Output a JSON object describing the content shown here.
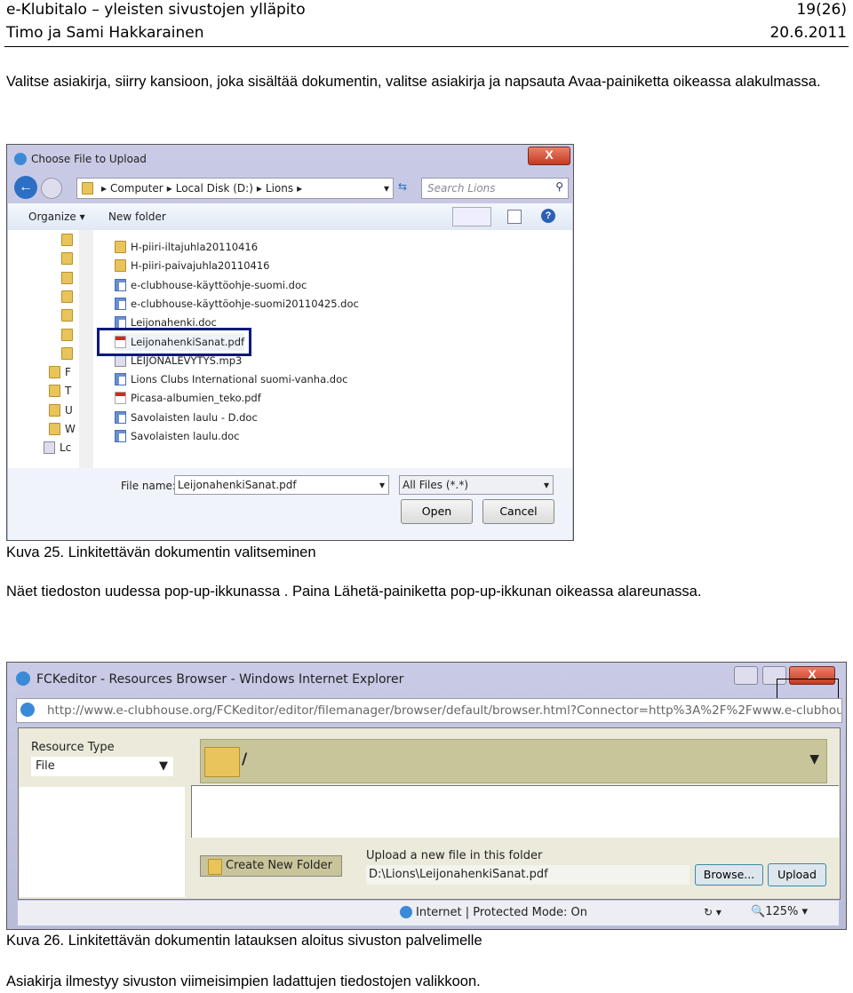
{
  "header": {
    "title": "e-Klubitalo – yleisten sivustojen ylläpito",
    "page": "19(26)",
    "authors": "Timo ja Sami Hakkarainen",
    "date": "20.6.2011"
  },
  "para1": "Valitse asiakirja, siirry kansioon, joka sisältää dokumentin, valitse asiakirja ja napsauta Avaa-painiketta oikeassa alakulmassa.",
  "dialog1": {
    "title": "Choose File to Upload",
    "close": "X",
    "breadcrumb": [
      "Computer",
      "Local Disk (D:)",
      "Lions"
    ],
    "search_placeholder": "Search Lions",
    "organize": "Organize ▾",
    "new_folder": "New folder",
    "nav_items": [
      "",
      "",
      "",
      "",
      "",
      "",
      "",
      "F",
      "T",
      "U",
      "W",
      "Lc"
    ],
    "files": [
      {
        "name": "H-piiri-iltajuhla20110416",
        "type": "folder"
      },
      {
        "name": "H-piiri-paivajuhla20110416",
        "type": "folder"
      },
      {
        "name": "e-clubhouse-käyttöohje-suomi.doc",
        "type": "doc"
      },
      {
        "name": "e-clubhouse-käyttöohje-suomi20110425.doc",
        "type": "doc"
      },
      {
        "name": "Leijonahenki.doc",
        "type": "doc"
      },
      {
        "name": "LeijonahenkiSanat.pdf",
        "type": "pdf",
        "selected": true
      },
      {
        "name": "LEIJONALEVYTYS.mp3",
        "type": "mp3"
      },
      {
        "name": "Lions Clubs International suomi-vanha.doc",
        "type": "doc"
      },
      {
        "name": "Picasa-albumien_teko.pdf",
        "type": "pdf"
      },
      {
        "name": "Savolaisten laulu - D.doc",
        "type": "doc"
      },
      {
        "name": "Savolaisten laulu.doc",
        "type": "doc"
      }
    ],
    "file_name_label": "File name:",
    "file_name_value": "LeijonahenkiSanat.pdf",
    "filter": "All Files (*.*)",
    "open": "Open",
    "cancel": "Cancel",
    "highlight_color": "#0a1a7a"
  },
  "caption1": "Kuva 25. Linkitettävän dokumentin valitseminen",
  "para2": "Näet tiedoston uudessa pop-up-ikkunassa . Paina Lähetä-painiketta pop-up-ikkunan oikeassa alareunassa.",
  "dialog2": {
    "title": "FCKeditor - Resources Browser - Windows Internet Explorer",
    "url": "http://www.e-clubhouse.org/FCKeditor/editor/filemanager/browser/default/browser.html?Connector=http%3A%2F%2Fwww.e-clubhou",
    "resource_type_label": "Resource Type",
    "resource_type_value": "File",
    "folder_path": "/",
    "create_folder": "Create New Folder",
    "upload_label": "Upload a new file in this folder",
    "upload_value": "D:\\Lions\\LeijonahenkiSanat.pdf",
    "browse": "Browse...",
    "upload": "Upload",
    "status": "Internet | Protected Mode: On",
    "zoom": "125%",
    "close": "X",
    "panel_color": "#c9c59a"
  },
  "caption2": "Kuva 26. Linkitettävän dokumentin latauksen aloitus sivuston palvelimelle",
  "para3": "Asiakirja ilmestyy sivuston viimeisimpien ladattujen tiedostojen valikkoon."
}
